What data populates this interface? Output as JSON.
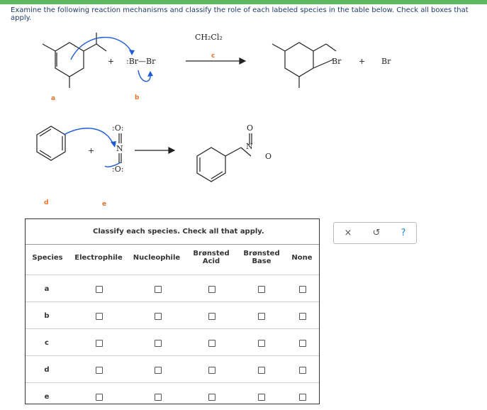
{
  "question_text": "Examine the following reaction mechanisms and classify the role of each labeled species in the table below. Check all boxes that apply.",
  "scheme": {
    "solvent": "CH₂Cl₂",
    "labels": {
      "a": "a",
      "b": "b",
      "c": "c",
      "d": "d",
      "e": "e"
    },
    "reagent1": ":Br—Br",
    "product1_tail": "Br",
    "plus": "+",
    "oxygen_top": ":O:",
    "oxygen_bottom": ":O:",
    "nitrogen": "N",
    "product_oxygen": "O"
  },
  "table": {
    "instruction": "Classify each species. Check all that apply.",
    "columns": [
      "Species",
      "Electrophile",
      "Nucleophile",
      "Brønsted Acid",
      "Brønsted Base",
      "None"
    ],
    "rows": [
      "a",
      "b",
      "c",
      "d",
      "e"
    ]
  },
  "toolbox": {
    "clear": "×",
    "undo": "↺",
    "help": "?"
  },
  "colors": {
    "accent": "#5cb85c",
    "label": "#e8732a",
    "arrow": "#1e5bd6",
    "text": "#1f3b6b"
  }
}
